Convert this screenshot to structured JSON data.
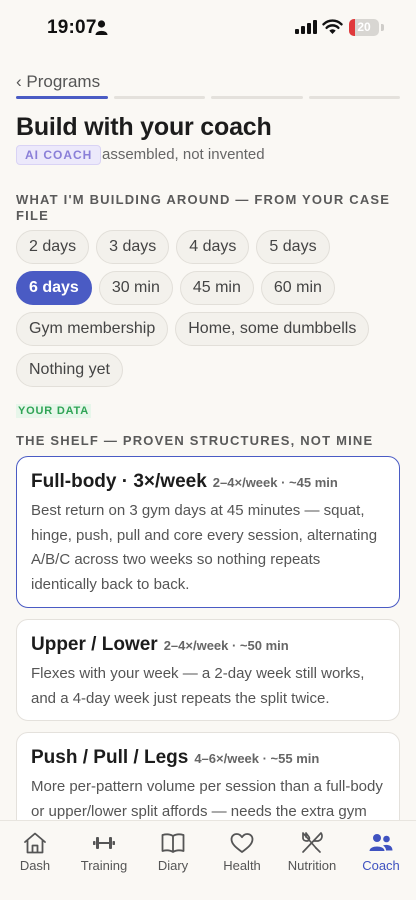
{
  "status_bar": {
    "time": "19:07",
    "battery": "20",
    "battery_level": 0.2,
    "battery_color": "#e0393b"
  },
  "nav": {
    "back_label": "Programs",
    "progress_total": 4,
    "progress_current": 1
  },
  "title": "Build with your coach",
  "ai_badge": "AI COACH",
  "ai_subtitle": "assembled, not invented",
  "section_building": "WHAT I'M BUILDING AROUND — FROM YOUR CASE FILE",
  "chips": {
    "days": [
      "2 days",
      "3 days",
      "4 days",
      "5 days"
    ],
    "sessions": [
      "6 days",
      "30 min",
      "45 min",
      "60 min"
    ],
    "equipment": [
      "Gym membership",
      "Home, some dumbbells"
    ],
    "other": [
      "Nothing yet"
    ]
  },
  "your_data_badge": "YOUR DATA",
  "section_shelf": "THE SHELF — PROVEN STRUCTURES, NOT MINE",
  "cards": [
    {
      "name": "Full-body · 3×/week",
      "meta": "2–4×/week · ~45 min",
      "desc": "Best return on 3 gym days at 45 minutes — squat, hinge, push, pull and core every session, alternating A/B/C across two weeks so nothing repeats identically back to back.",
      "selected": true
    },
    {
      "name": "Upper / Lower",
      "meta": "2–4×/week · ~50 min",
      "desc": "Flexes with your week — a 2-day week still works, and a 4-day week just repeats the split twice.",
      "selected": false
    },
    {
      "name": "Push / Pull / Legs",
      "meta": "4–6×/week · ~55 min",
      "desc": "More per-pattern volume per session than a full-body or upper/lower split affords — needs the extra gym",
      "selected": false
    }
  ],
  "tabs": [
    {
      "label": "Dash",
      "icon": "house-icon"
    },
    {
      "label": "Training",
      "icon": "dumbbell-icon"
    },
    {
      "label": "Diary",
      "icon": "book-icon"
    },
    {
      "label": "Health",
      "icon": "heart-icon"
    },
    {
      "label": "Nutrition",
      "icon": "fork-knife-icon"
    },
    {
      "label": "Coach",
      "icon": "people-icon",
      "active": true
    }
  ],
  "colors": {
    "accent": "#4a5bc4",
    "background": "#faf8f4",
    "your_data_green": "#2fa455",
    "ai_badge_purple": "#8a7fd8"
  }
}
